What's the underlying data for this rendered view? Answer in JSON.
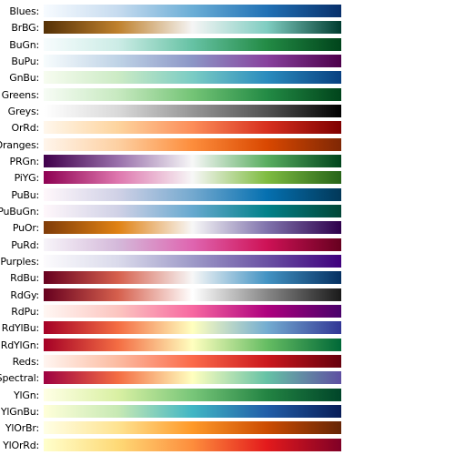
{
  "palettes": [
    {
      "label": "Blues:",
      "colors": [
        "#f7fbff",
        "#c6dbef",
        "#6baed6",
        "#2171b5",
        "#08306b"
      ]
    },
    {
      "label": "BrBG:",
      "colors": [
        "#543005",
        "#bf812d",
        "#f5f5f5",
        "#80cdc1",
        "#003c30"
      ]
    },
    {
      "label": "BuGn:",
      "colors": [
        "#f7fcfd",
        "#ccece6",
        "#66c2a4",
        "#238b45",
        "#00441b"
      ]
    },
    {
      "label": "BuPu:",
      "colors": [
        "#f7fcfd",
        "#bfd3e6",
        "#8c96c6",
        "#88419d",
        "#4d004b"
      ]
    },
    {
      "label": "GnBu:",
      "colors": [
        "#f7fcf0",
        "#ccebc5",
        "#7bccc4",
        "#2b8cbe",
        "#084081"
      ]
    },
    {
      "label": "Greens:",
      "colors": [
        "#f7fcf5",
        "#c7e9c0",
        "#74c476",
        "#238b45",
        "#00441b"
      ]
    },
    {
      "label": "Greys:",
      "colors": [
        "#ffffff",
        "#d9d9d9",
        "#969696",
        "#525252",
        "#000000"
      ]
    },
    {
      "label": "OrRd:",
      "colors": [
        "#fff7ec",
        "#fdd49e",
        "#fc8d59",
        "#d7301f",
        "#7f0000"
      ]
    },
    {
      "label": "Oranges:",
      "colors": [
        "#fff5eb",
        "#fdd0a2",
        "#fd8d3c",
        "#d94801",
        "#7f2704"
      ]
    },
    {
      "label": "PRGn:",
      "colors": [
        "#40004b",
        "#9970ab",
        "#f7f7f7",
        "#5aae61",
        "#00441b"
      ]
    },
    {
      "label": "PiYG:",
      "colors": [
        "#8e0152",
        "#de77ae",
        "#f7f7f7",
        "#7fbc41",
        "#276419"
      ]
    },
    {
      "label": "PuBu:",
      "colors": [
        "#fff7fb",
        "#d0d1e6",
        "#74a9cf",
        "#0570b0",
        "#023858"
      ]
    },
    {
      "label": "PuBuGn:",
      "colors": [
        "#fff7fb",
        "#d0d1e6",
        "#67a9cf",
        "#02818a",
        "#014636"
      ]
    },
    {
      "label": "PuOr:",
      "colors": [
        "#7f3b08",
        "#e08214",
        "#f7f7f7",
        "#8073ac",
        "#2d004b"
      ]
    },
    {
      "label": "PuRd:",
      "colors": [
        "#f7f4f9",
        "#d4b9da",
        "#df65b0",
        "#ce1256",
        "#67001f"
      ]
    },
    {
      "label": "Purples:",
      "colors": [
        "#fcfbfd",
        "#dadaeb",
        "#9e9ac8",
        "#6a51a3",
        "#3f007d"
      ]
    },
    {
      "label": "RdBu:",
      "colors": [
        "#67001f",
        "#d6604d",
        "#f7f7f7",
        "#4393c3",
        "#053061"
      ]
    },
    {
      "label": "RdGy:",
      "colors": [
        "#67001f",
        "#d6604d",
        "#ffffff",
        "#878787",
        "#1a1a1a"
      ]
    },
    {
      "label": "RdPu:",
      "colors": [
        "#fff7f3",
        "#fcc5c0",
        "#f768a1",
        "#ae017e",
        "#49006a"
      ]
    },
    {
      "label": "RdYlBu:",
      "colors": [
        "#a50026",
        "#f46d43",
        "#ffffbf",
        "#74add1",
        "#313695"
      ]
    },
    {
      "label": "RdYlGn:",
      "colors": [
        "#a50026",
        "#f46d43",
        "#ffffbf",
        "#66bd63",
        "#006837"
      ]
    },
    {
      "label": "Reds:",
      "colors": [
        "#fff5f0",
        "#fcbba1",
        "#fb6a4a",
        "#cb181d",
        "#67000d"
      ]
    },
    {
      "label": "Spectral:",
      "colors": [
        "#9e0142",
        "#f46d43",
        "#ffffbf",
        "#66c2a5",
        "#5e4fa2"
      ]
    },
    {
      "label": "YlGn:",
      "colors": [
        "#ffffe5",
        "#d9f0a3",
        "#78c679",
        "#238443",
        "#004529"
      ]
    },
    {
      "label": "YlGnBu:",
      "colors": [
        "#ffffd9",
        "#c7e9b4",
        "#41b6c4",
        "#225ea8",
        "#081d58"
      ]
    },
    {
      "label": "YlOrBr:",
      "colors": [
        "#ffffe5",
        "#fee391",
        "#fe9929",
        "#cc4c02",
        "#662506"
      ]
    },
    {
      "label": "YlOrRd:",
      "colors": [
        "#ffffcc",
        "#fed976",
        "#fd8d3c",
        "#e31a1c",
        "#800026"
      ]
    }
  ]
}
